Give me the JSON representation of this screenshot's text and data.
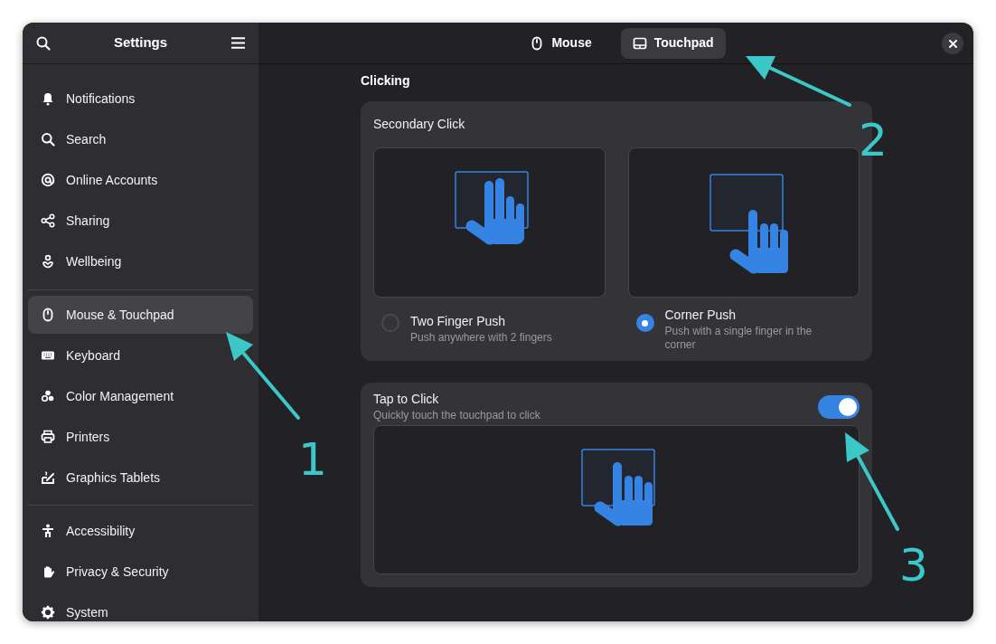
{
  "window": {
    "title": "Settings"
  },
  "sidebar": {
    "sections": [
      {
        "items": [
          {
            "label": "Notifications",
            "selected": false
          },
          {
            "label": "Search",
            "selected": false
          },
          {
            "label": "Online Accounts",
            "selected": false
          },
          {
            "label": "Sharing",
            "selected": false
          },
          {
            "label": "Wellbeing",
            "selected": false
          }
        ]
      },
      {
        "items": [
          {
            "label": "Mouse & Touchpad",
            "selected": true
          },
          {
            "label": "Keyboard",
            "selected": false
          },
          {
            "label": "Color Management",
            "selected": false
          },
          {
            "label": "Printers",
            "selected": false
          },
          {
            "label": "Graphics Tablets",
            "selected": false
          }
        ]
      },
      {
        "items": [
          {
            "label": "Accessibility",
            "selected": false
          },
          {
            "label": "Privacy & Security",
            "selected": false
          },
          {
            "label": "System",
            "selected": false
          }
        ]
      }
    ]
  },
  "tabs": [
    {
      "label": "Mouse",
      "kind": "mouse",
      "selected": false
    },
    {
      "label": "Touchpad",
      "kind": "touchpad",
      "selected": true
    }
  ],
  "section_title": "Clicking",
  "secondary_click": {
    "title": "Secondary Click",
    "options": [
      {
        "label": "Two Finger Push",
        "description": "Push anywhere with 2 fingers",
        "kind": "two-finger",
        "selected": false
      },
      {
        "label": "Corner Push",
        "description": "Push with a single finger in the corner",
        "kind": "corner",
        "selected": true
      }
    ]
  },
  "tap_to_click": {
    "title": "Tap to Click",
    "description": "Quickly touch the touchpad to click",
    "on": true
  },
  "annotations": [
    {
      "label": "1"
    },
    {
      "label": "2"
    },
    {
      "label": "3"
    }
  ]
}
